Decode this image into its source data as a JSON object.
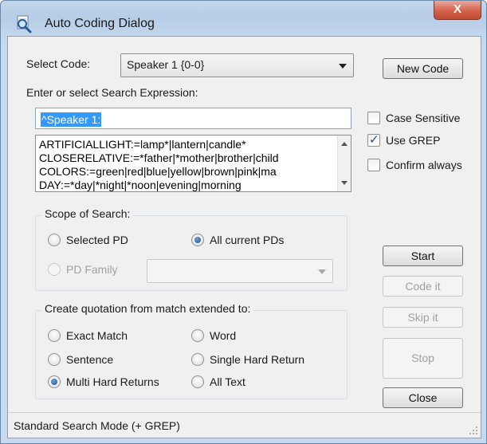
{
  "window": {
    "title": "Auto Coding Dialog",
    "close_glyph": "X"
  },
  "select_code": {
    "label": "Select Code:",
    "value": "Speaker 1 {0-0}"
  },
  "new_code_button": "New Code",
  "search": {
    "label": "Enter or select Search Expression:",
    "value": "^Speaker 1:",
    "expressions": [
      "ARTIFICIALLIGHT:=lamp*|lantern|candle*",
      "CLOSERELATIVE:=*father|*mother|brother|child",
      "COLORS:=green|red|blue|yellow|brown|pink|ma",
      "DAY:=*day|*night|*noon|evening|morning"
    ]
  },
  "options": {
    "case_sensitive": {
      "label": "Case Sensitive",
      "checked": false
    },
    "use_grep": {
      "label": "Use GREP",
      "checked": true
    },
    "confirm_always": {
      "label": "Confirm always",
      "checked": false
    }
  },
  "scope": {
    "title": "Scope of Search:",
    "selected_pd": "Selected PD",
    "all_current_pds": "All current PDs",
    "pd_family": "PD Family",
    "selected": "all_current_pds"
  },
  "extend": {
    "title": "Create quotation from match extended to:",
    "options": {
      "exact_match": "Exact Match",
      "word": "Word",
      "sentence": "Sentence",
      "single_hard_return": "Single Hard Return",
      "multi_hard_returns": "Multi Hard Returns",
      "all_text": "All Text"
    },
    "selected": "multi_hard_returns"
  },
  "buttons": {
    "start": "Start",
    "code_it": "Code it",
    "skip_it": "Skip it",
    "stop": "Stop",
    "close": "Close"
  },
  "status": "Standard Search Mode (+ GREP)",
  "icons": {
    "title": "magnifier-icon",
    "checkmark": "✓"
  },
  "colors": {
    "selection": "#3399ff",
    "close_button": "#d4614b",
    "titlebar": "#c4d8ec"
  }
}
